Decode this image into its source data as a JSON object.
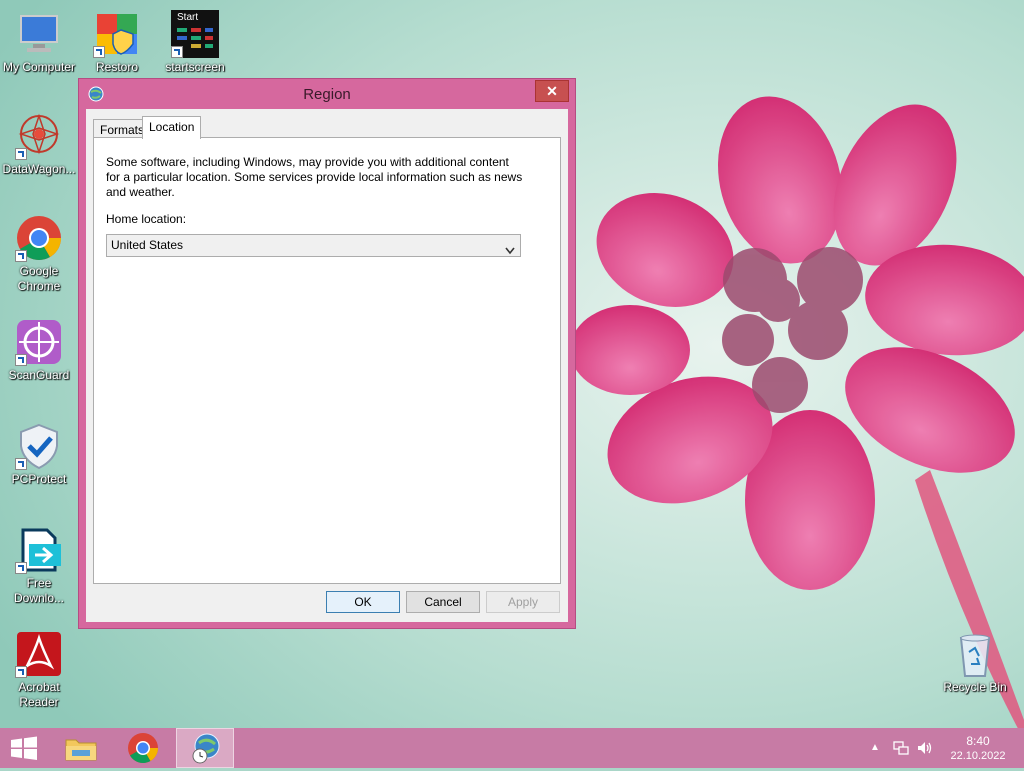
{
  "desktop": {
    "icons": [
      {
        "label": "My Computer"
      },
      {
        "label": "Restoro"
      },
      {
        "label": "startscreen",
        "thumb_text": "Start"
      },
      {
        "label": "DataWagon..."
      },
      {
        "label": "Google Chrome"
      },
      {
        "label": "ScanGuard"
      },
      {
        "label": "PCProtect"
      },
      {
        "label": "Free Downlo..."
      },
      {
        "label": "Acrobat Reader"
      },
      {
        "label": "Recycle Bin"
      }
    ]
  },
  "window": {
    "title": "Region",
    "close_glyph": "✕",
    "tabs": [
      {
        "label": "Formats"
      },
      {
        "label": "Location",
        "active": true
      }
    ],
    "location": {
      "description": "Some software, including Windows, may provide you with additional content for a particular location. Some services provide local information such as news and weather.",
      "home_location_label": "Home location:",
      "home_location_value": "United States"
    },
    "buttons": {
      "ok": "OK",
      "cancel": "Cancel",
      "apply": "Apply"
    }
  },
  "taskbar": {
    "clock_time": "8:40",
    "clock_date": "22.10.2022",
    "tray_arrow": "▲"
  },
  "colors": {
    "window_frame": "#d6689e",
    "taskbar": "#c77ba5",
    "close_button": "#c75050"
  }
}
